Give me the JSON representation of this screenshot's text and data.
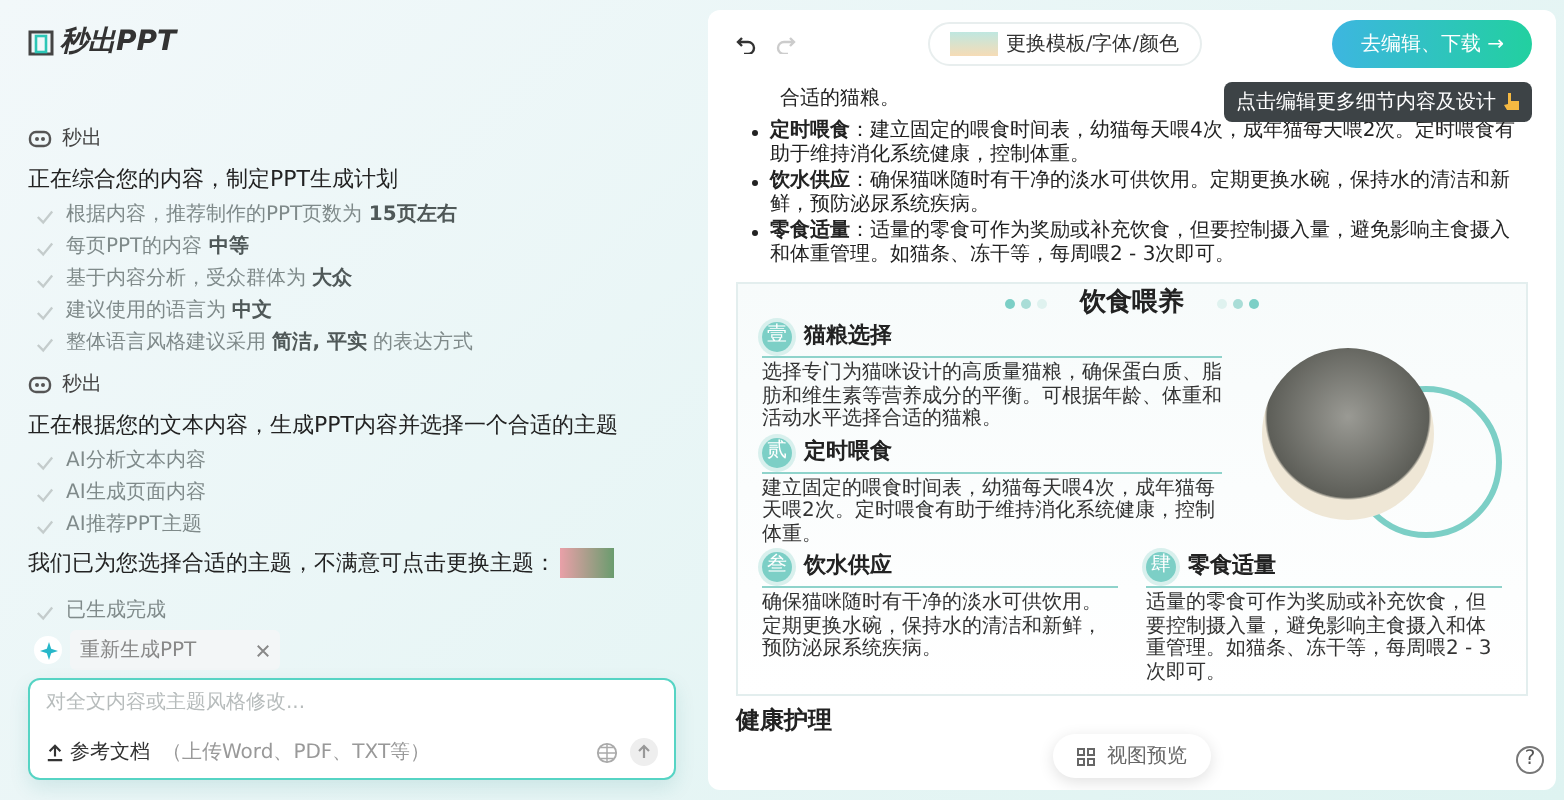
{
  "logo": {
    "text": "秒出PPT"
  },
  "chat": [
    {
      "kind": "agent",
      "text": "秒出"
    },
    {
      "kind": "heading",
      "text": "正在综合您的内容，制定PPT生成计划"
    },
    {
      "kind": "step",
      "text": "根据内容，推荐制作的PPT页数为 **15页左右**"
    },
    {
      "kind": "step",
      "text": "每页PPT的内容 **中等**"
    },
    {
      "kind": "step",
      "text": "基于内容分析，受众群体为 **大众**"
    },
    {
      "kind": "step",
      "text": "建议使用的语言为 **中文**"
    },
    {
      "kind": "step",
      "text": "整体语言风格建议采用 **简洁, 平实** 的表达方式"
    },
    {
      "kind": "agent",
      "text": "秒出"
    },
    {
      "kind": "heading",
      "text": "正在根据您的文本内容，生成PPT内容并选择一个合适的主题"
    },
    {
      "kind": "step",
      "text": "AI分析文本内容"
    },
    {
      "kind": "step",
      "text": "AI生成页面内容"
    },
    {
      "kind": "step",
      "text": "AI推荐PPT主题"
    },
    {
      "kind": "theme",
      "text": "我们已为您选择合适的主题，不满意可点击更换主题："
    },
    {
      "kind": "step",
      "text": "已生成完成"
    }
  ],
  "chip": {
    "label": "重新生成PPT"
  },
  "composer": {
    "placeholder": "对全文内容或主题风格修改...",
    "attach_label": "参考文档",
    "attach_hint": "（上传Word、PDF、TXT等）"
  },
  "toolbar": {
    "redo_disabled": true,
    "theme_button": "更换模板/字体/颜色",
    "edit_button": "去编辑、下载 →",
    "tooltip": "点击编辑更多细节内容及设计"
  },
  "doc": {
    "intro": "合适的猫粮。",
    "bullets": [
      "**定时喂食**：建立固定的喂食时间表，幼猫每天喂4次，成年猫每天喂2次。定时喂食有助于维持消化系统健康，控制体重。",
      "**饮水供应**：确保猫咪随时有干净的淡水可供饮用。定期更换水碗，保持水的清洁和新鲜，预防泌尿系统疾病。",
      "**零食适量**：适量的零食可作为奖励或补充饮食，但要控制摄入量，避免影响主食摄入和体重管理。如猫条、冻干等，每周喂2 - 3次即可。"
    ],
    "slide": {
      "title": "饮食喂养",
      "sections": [
        {
          "badge": "壹",
          "title": "猫粮选择",
          "text": "选择专门为猫咪设计的高质量猫粮，确保蛋白质、脂肪和维生素等营养成分的平衡。可根据年龄、体重和活动水平选择合适的猫粮。"
        },
        {
          "badge": "贰",
          "title": "定时喂食",
          "text": "建立固定的喂食时间表，幼猫每天喂4次，成年猫每天喂2次。定时喂食有助于维持消化系统健康，控制体重。"
        },
        {
          "badge": "叁",
          "title": "饮水供应",
          "text": "确保猫咪随时有干净的淡水可供饮用。定期更换水碗，保持水的清洁和新鲜，预防泌尿系统疾病。"
        },
        {
          "badge": "肆",
          "title": "零食适量",
          "text": "适量的零食可作为奖励或补充饮食，但要控制摄入量，避免影响主食摄入和体重管理。如猫条、冻干等，每周喂2 - 3次即可。"
        }
      ]
    },
    "section_heading": "健康护理"
  },
  "preview_button": "视图预览",
  "help_button": "?"
}
